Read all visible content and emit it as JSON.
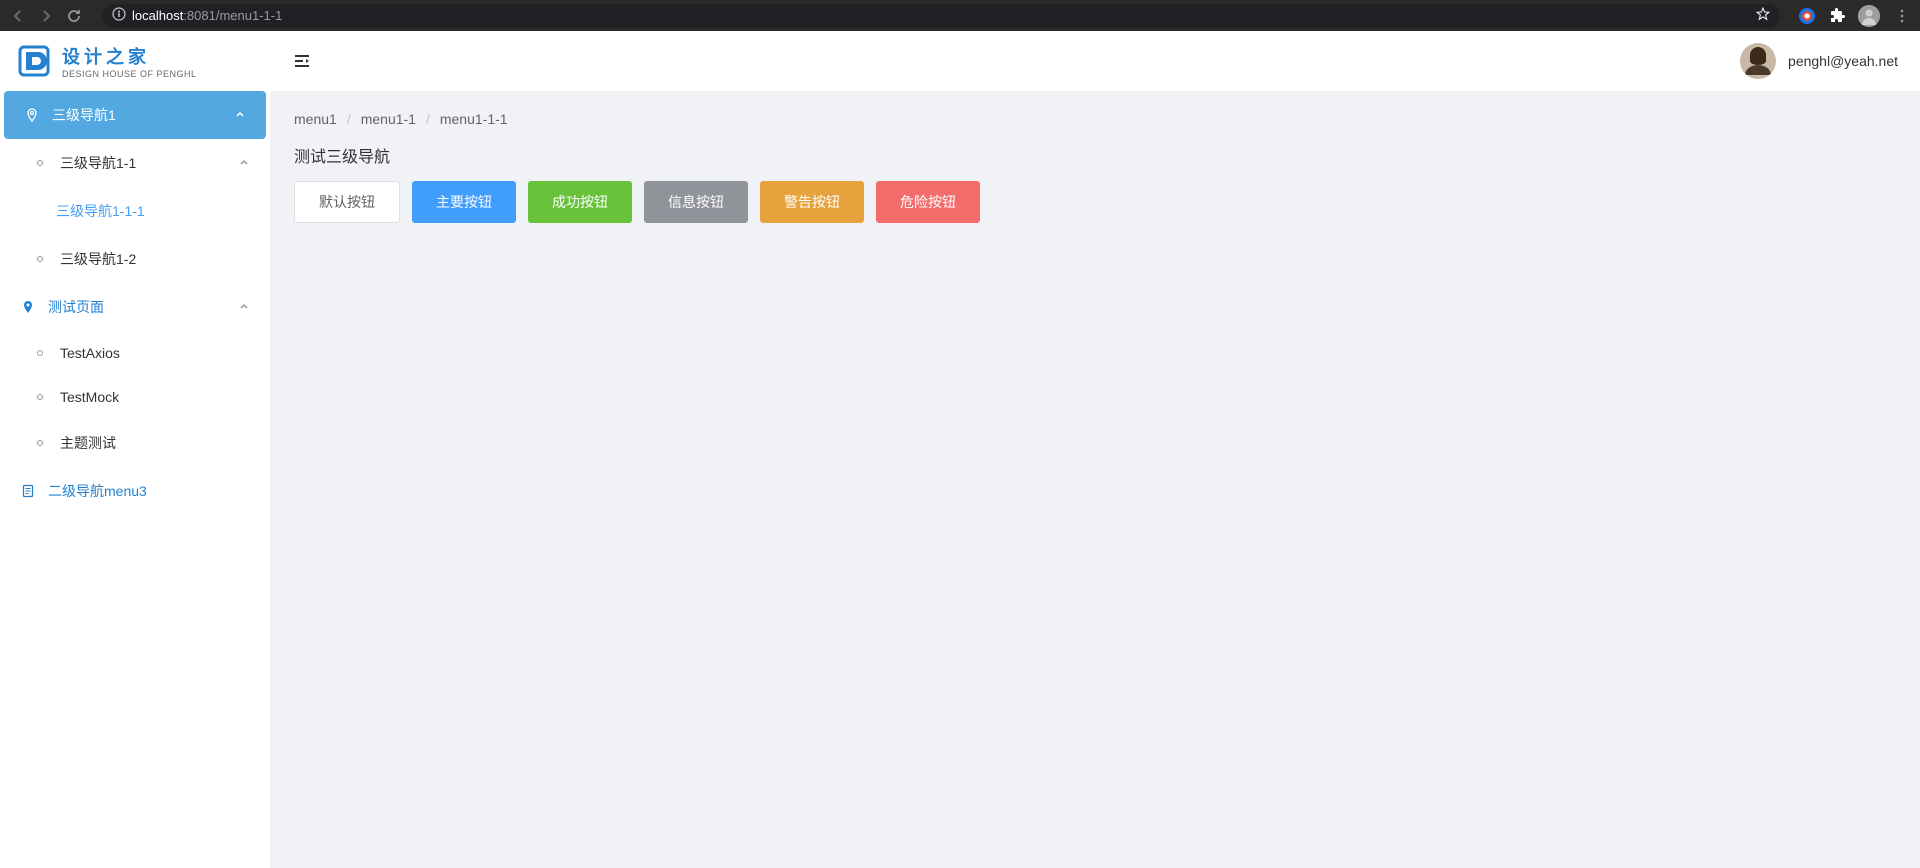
{
  "browser": {
    "url_host": "localhost",
    "url_port": ":8081",
    "url_path": "/menu1-1-1"
  },
  "logo": {
    "main": "设计之家",
    "sub": "DESIGN HOUSE OF PENGHL"
  },
  "sidebar": {
    "nav1": "三级导航1",
    "nav1_1": "三级导航1-1",
    "nav1_1_1": "三级导航1-1-1",
    "nav1_2": "三级导航1-2",
    "testpage": "测试页面",
    "testaxios": "TestAxios",
    "testmock": "TestMock",
    "themetest": "主题测试",
    "menu3": "二级导航menu3"
  },
  "user": {
    "email": "penghl@yeah.net"
  },
  "breadcrumb": {
    "a": "menu1",
    "b": "menu1-1",
    "c": "menu1-1-1",
    "sep": "/"
  },
  "page": {
    "title": "测试三级导航"
  },
  "buttons": {
    "default": "默认按钮",
    "primary": "主要按钮",
    "success": "成功按钮",
    "info": "信息按钮",
    "warning": "警告按钮",
    "danger": "危险按钮"
  }
}
